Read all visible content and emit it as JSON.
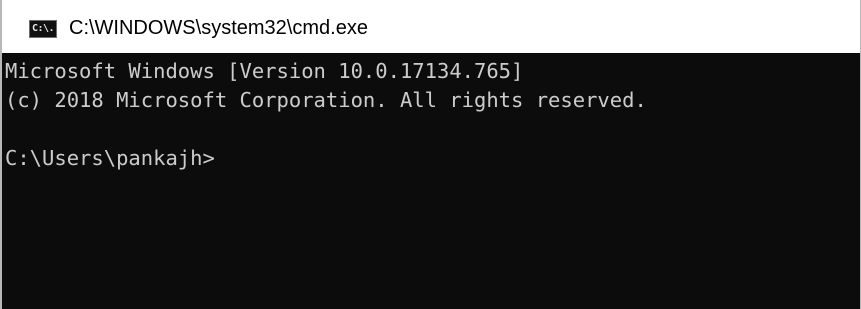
{
  "window": {
    "title": "C:\\WINDOWS\\system32\\cmd.exe",
    "icon": "cmd-terminal-icon",
    "icon_glyph": "C:\\."
  },
  "console": {
    "lines": [
      "Microsoft Windows [Version 10.0.17134.765]",
      "(c) 2018 Microsoft Corporation. All rights reserved.",
      "",
      "C:\\Users\\pankajh>"
    ],
    "background_color": "#0c0c0c",
    "text_color": "#cccccc"
  }
}
